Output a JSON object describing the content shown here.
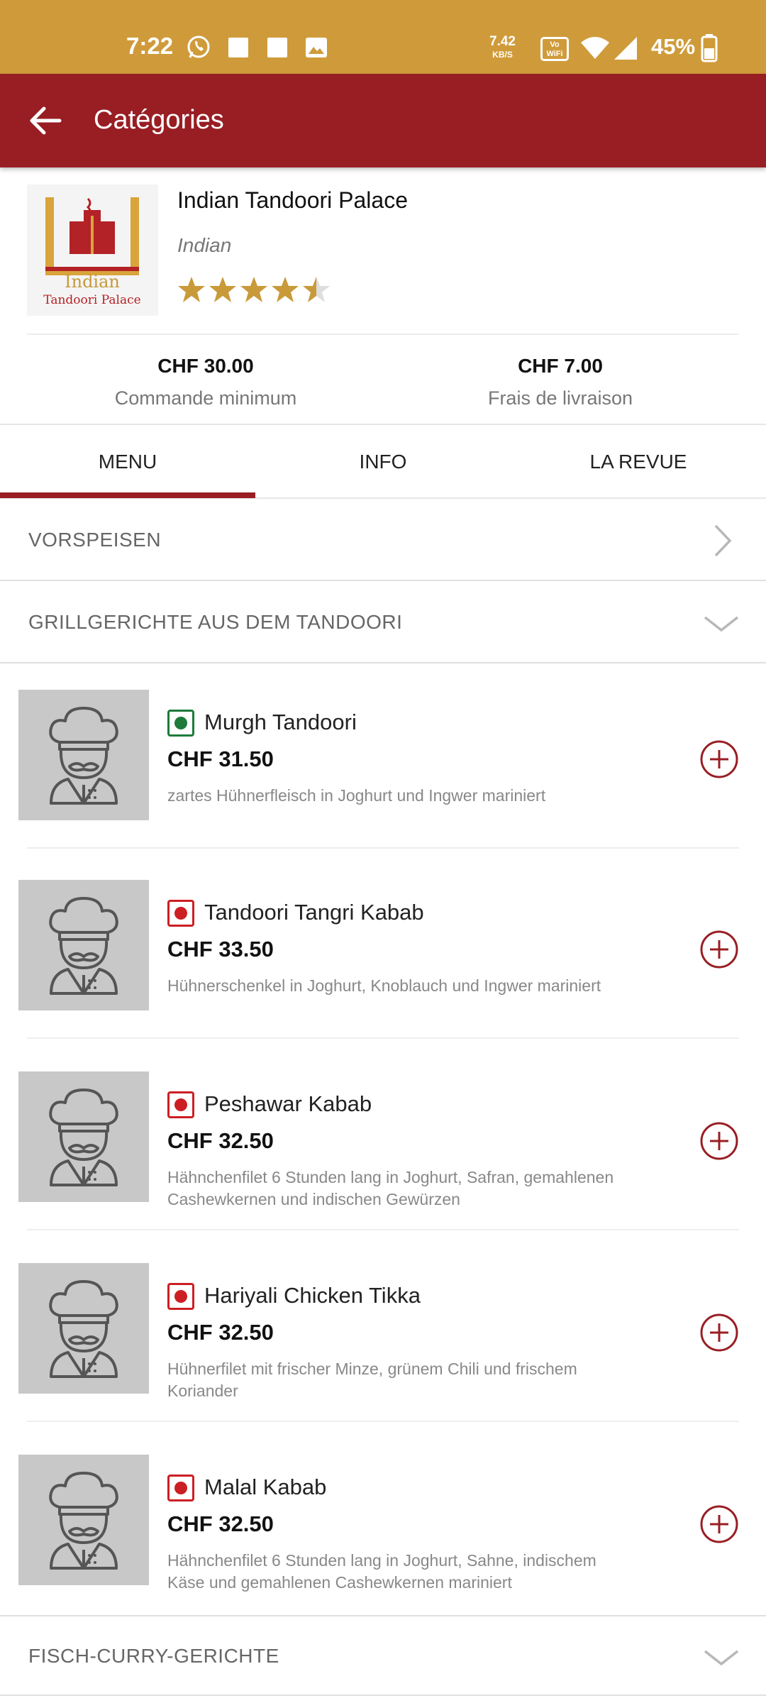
{
  "status_bar": {
    "time": "7:22",
    "net_rate": "7.42",
    "net_unit": "KB/S",
    "wifi_call": "Vo\nWiFi",
    "battery": "45%"
  },
  "app_bar": {
    "title": "Catégories"
  },
  "restaurant": {
    "name": "Indian Tandoori Palace",
    "cuisine": "Indian",
    "logo_text_line1": "Indian",
    "logo_text_line2": "Tandoori Palace",
    "rating": 4.5,
    "min_order_value": "CHF 30.00",
    "min_order_label": "Commande minimum",
    "delivery_fee_value": "CHF 7.00",
    "delivery_fee_label": "Frais de livraison"
  },
  "tabs": [
    {
      "label": "MENU",
      "active": true
    },
    {
      "label": "INFO",
      "active": false
    },
    {
      "label": "LA REVUE",
      "active": false
    }
  ],
  "categories": [
    {
      "label": "VORSPEISEN",
      "state": "collapsed"
    },
    {
      "label": "GRILLGERICHTE AUS DEM TANDOORI",
      "state": "expanded"
    },
    {
      "label": "FISCH-CURRY-GERICHTE",
      "state": "collapsed"
    }
  ],
  "items": [
    {
      "name": "Murgh Tandoori",
      "price": "CHF 31.50",
      "desc": "zartes Hühnerfleisch in Joghurt und Ingwer mariniert",
      "diet": "veg",
      "diet_color": "#1e7a3a"
    },
    {
      "name": "Tandoori Tangri Kabab",
      "price": "CHF 33.50",
      "desc": "Hühnerschenkel in Joghurt, Knoblauch und Ingwer mariniert",
      "diet": "non-veg",
      "diet_color": "#cc1f24"
    },
    {
      "name": "Peshawar Kabab",
      "price": "CHF 32.50",
      "desc": "Hähnchenfilet 6 Stunden lang in Joghurt, Safran, gemahlenen Cashewkernen und indischen Gewürzen",
      "diet": "non-veg",
      "diet_color": "#cc1f24"
    },
    {
      "name": "Hariyali Chicken Tikka",
      "price": "CHF 32.50",
      "desc": "Hühnerfilet mit frischer Minze, grünem Chili und frischem Koriander",
      "diet": "non-veg",
      "diet_color": "#cc1f24"
    },
    {
      "name": "Malal Kabab",
      "price": "CHF 32.50",
      "desc": "Hähnchenfilet 6 Stunden lang in Joghurt, Sahne, indischem Käse und gemahlenen Cashewkernen mariniert",
      "diet": "non-veg",
      "diet_color": "#cc1f24"
    }
  ],
  "colors": {
    "status_bar": "#cf9b3a",
    "app_bar": "#981e23",
    "star": "#c99a3a",
    "add_button": "#981e23"
  },
  "icons": {
    "back": "arrow-left-icon",
    "chevron_right": "chevron-right-icon",
    "chevron_down": "chevron-down-icon",
    "add": "plus-circle-icon",
    "chef": "chef-placeholder-icon"
  }
}
